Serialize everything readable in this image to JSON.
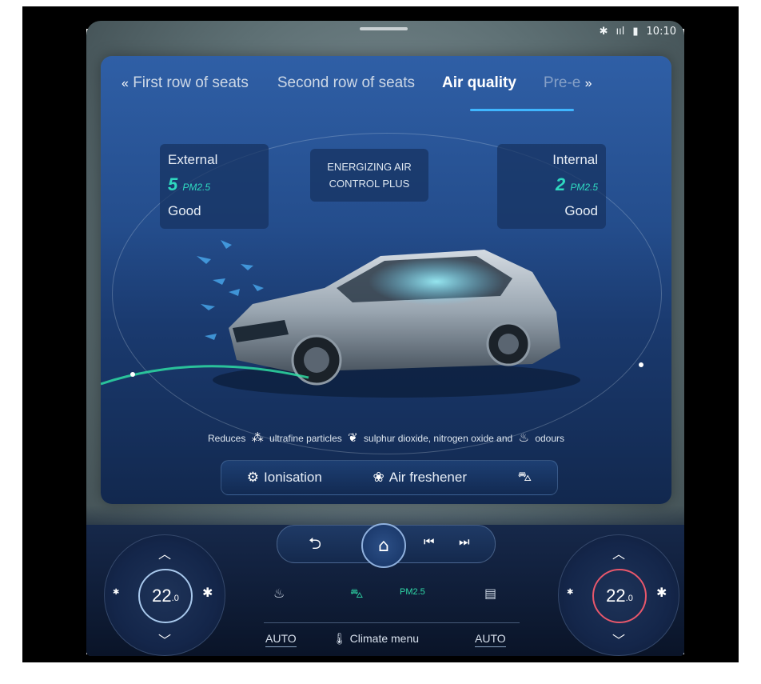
{
  "status": {
    "bluetooth": "✱",
    "signal": "ııl",
    "battery": "▮",
    "time": "10:10"
  },
  "tabs": [
    {
      "label": "First row of seats",
      "active": false
    },
    {
      "label": "Second row of seats",
      "active": false
    },
    {
      "label": "Air quality",
      "active": true
    },
    {
      "label": "Pre-e",
      "active": false
    }
  ],
  "tab_arrows": {
    "left": "«",
    "right": "»"
  },
  "external": {
    "title": "External",
    "value": "5",
    "unit": "PM2.5",
    "status": "Good"
  },
  "internal": {
    "title": "Internal",
    "value": "2",
    "unit": "PM2.5",
    "status": "Good"
  },
  "energizing": {
    "line1": "ENERGIZING AIR",
    "line2": "CONTROL PLUS"
  },
  "reduces": {
    "prefix": "Reduces",
    "item1": "ultrafine particles",
    "item2": "sulphur dioxide, nitrogen oxide and",
    "item3": "odours"
  },
  "features": {
    "ionisation": "Ionisation",
    "air_freshener": "Air freshener"
  },
  "climate": {
    "left_temp": "22",
    "left_temp_decimal": ".0",
    "right_temp": "22",
    "right_temp_decimal": ".0",
    "pm_label": "PM2.5",
    "auto_left": "AUTO",
    "auto_right": "AUTO",
    "climate_menu": "Climate menu"
  },
  "colors": {
    "accent": "#3fb6ff",
    "pm_green": "#2fd9c0",
    "panel": "#244d8c"
  }
}
